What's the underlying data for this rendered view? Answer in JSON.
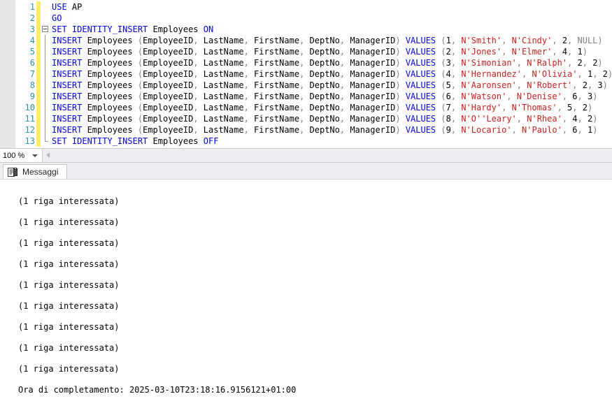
{
  "editor": {
    "zoom_level": "100 %",
    "lines": [
      {
        "number": "1",
        "fold": "none",
        "tokens": [
          {
            "t": "kw",
            "s": "USE"
          },
          {
            "t": "pun",
            "s": " "
          },
          {
            "t": "id",
            "s": "AP"
          }
        ]
      },
      {
        "number": "2",
        "fold": "none",
        "tokens": [
          {
            "t": "kw",
            "s": "GO"
          }
        ]
      },
      {
        "number": "3",
        "fold": "start",
        "tokens": [
          {
            "t": "kw",
            "s": "SET IDENTITY_INSERT"
          },
          {
            "t": "id",
            "s": " Employees "
          },
          {
            "t": "kw",
            "s": "ON"
          }
        ]
      },
      {
        "number": "4",
        "fold": "mid",
        "tokens": [
          {
            "t": "kw",
            "s": "INSERT"
          },
          {
            "t": "id",
            "s": " Employees "
          },
          {
            "t": "pun",
            "s": "("
          },
          {
            "t": "id",
            "s": "EmployeeID"
          },
          {
            "t": "pun",
            "s": ", "
          },
          {
            "t": "id",
            "s": "LastName"
          },
          {
            "t": "pun",
            "s": ", "
          },
          {
            "t": "id",
            "s": "FirstName"
          },
          {
            "t": "pun",
            "s": ", "
          },
          {
            "t": "id",
            "s": "DeptNo"
          },
          {
            "t": "pun",
            "s": ", "
          },
          {
            "t": "id",
            "s": "ManagerID"
          },
          {
            "t": "pun",
            "s": ") "
          },
          {
            "t": "kw",
            "s": "VALUES"
          },
          {
            "t": "pun",
            "s": " ("
          },
          {
            "t": "num",
            "s": "1"
          },
          {
            "t": "pun",
            "s": ", "
          },
          {
            "t": "str",
            "s": "N'Smith'"
          },
          {
            "t": "pun",
            "s": ", "
          },
          {
            "t": "str",
            "s": "N'Cindy'"
          },
          {
            "t": "pun",
            "s": ", "
          },
          {
            "t": "num",
            "s": "2"
          },
          {
            "t": "pun",
            "s": ", "
          },
          {
            "t": "null",
            "s": "NULL"
          },
          {
            "t": "pun",
            "s": ")"
          }
        ]
      },
      {
        "number": "5",
        "fold": "mid",
        "tokens": [
          {
            "t": "kw",
            "s": "INSERT"
          },
          {
            "t": "id",
            "s": " Employees "
          },
          {
            "t": "pun",
            "s": "("
          },
          {
            "t": "id",
            "s": "EmployeeID"
          },
          {
            "t": "pun",
            "s": ", "
          },
          {
            "t": "id",
            "s": "LastName"
          },
          {
            "t": "pun",
            "s": ", "
          },
          {
            "t": "id",
            "s": "FirstName"
          },
          {
            "t": "pun",
            "s": ", "
          },
          {
            "t": "id",
            "s": "DeptNo"
          },
          {
            "t": "pun",
            "s": ", "
          },
          {
            "t": "id",
            "s": "ManagerID"
          },
          {
            "t": "pun",
            "s": ") "
          },
          {
            "t": "kw",
            "s": "VALUES"
          },
          {
            "t": "pun",
            "s": " ("
          },
          {
            "t": "num",
            "s": "2"
          },
          {
            "t": "pun",
            "s": ", "
          },
          {
            "t": "str",
            "s": "N'Jones'"
          },
          {
            "t": "pun",
            "s": ", "
          },
          {
            "t": "str",
            "s": "N'Elmer'"
          },
          {
            "t": "pun",
            "s": ", "
          },
          {
            "t": "num",
            "s": "4"
          },
          {
            "t": "pun",
            "s": ", "
          },
          {
            "t": "num",
            "s": "1"
          },
          {
            "t": "pun",
            "s": ")"
          }
        ]
      },
      {
        "number": "6",
        "fold": "mid",
        "tokens": [
          {
            "t": "kw",
            "s": "INSERT"
          },
          {
            "t": "id",
            "s": " Employees "
          },
          {
            "t": "pun",
            "s": "("
          },
          {
            "t": "id",
            "s": "EmployeeID"
          },
          {
            "t": "pun",
            "s": ", "
          },
          {
            "t": "id",
            "s": "LastName"
          },
          {
            "t": "pun",
            "s": ", "
          },
          {
            "t": "id",
            "s": "FirstName"
          },
          {
            "t": "pun",
            "s": ", "
          },
          {
            "t": "id",
            "s": "DeptNo"
          },
          {
            "t": "pun",
            "s": ", "
          },
          {
            "t": "id",
            "s": "ManagerID"
          },
          {
            "t": "pun",
            "s": ") "
          },
          {
            "t": "kw",
            "s": "VALUES"
          },
          {
            "t": "pun",
            "s": " ("
          },
          {
            "t": "num",
            "s": "3"
          },
          {
            "t": "pun",
            "s": ", "
          },
          {
            "t": "str",
            "s": "N'Simonian'"
          },
          {
            "t": "pun",
            "s": ", "
          },
          {
            "t": "str",
            "s": "N'Ralph'"
          },
          {
            "t": "pun",
            "s": ", "
          },
          {
            "t": "num",
            "s": "2"
          },
          {
            "t": "pun",
            "s": ", "
          },
          {
            "t": "num",
            "s": "2"
          },
          {
            "t": "pun",
            "s": ")"
          }
        ]
      },
      {
        "number": "7",
        "fold": "mid",
        "tokens": [
          {
            "t": "kw",
            "s": "INSERT"
          },
          {
            "t": "id",
            "s": " Employees "
          },
          {
            "t": "pun",
            "s": "("
          },
          {
            "t": "id",
            "s": "EmployeeID"
          },
          {
            "t": "pun",
            "s": ", "
          },
          {
            "t": "id",
            "s": "LastName"
          },
          {
            "t": "pun",
            "s": ", "
          },
          {
            "t": "id",
            "s": "FirstName"
          },
          {
            "t": "pun",
            "s": ", "
          },
          {
            "t": "id",
            "s": "DeptNo"
          },
          {
            "t": "pun",
            "s": ", "
          },
          {
            "t": "id",
            "s": "ManagerID"
          },
          {
            "t": "pun",
            "s": ") "
          },
          {
            "t": "kw",
            "s": "VALUES"
          },
          {
            "t": "pun",
            "s": " ("
          },
          {
            "t": "num",
            "s": "4"
          },
          {
            "t": "pun",
            "s": ", "
          },
          {
            "t": "str",
            "s": "N'Hernandez'"
          },
          {
            "t": "pun",
            "s": ", "
          },
          {
            "t": "str",
            "s": "N'Olivia'"
          },
          {
            "t": "pun",
            "s": ", "
          },
          {
            "t": "num",
            "s": "1"
          },
          {
            "t": "pun",
            "s": ", "
          },
          {
            "t": "num",
            "s": "2"
          },
          {
            "t": "pun",
            "s": ")"
          }
        ]
      },
      {
        "number": "8",
        "fold": "mid",
        "tokens": [
          {
            "t": "kw",
            "s": "INSERT"
          },
          {
            "t": "id",
            "s": " Employees "
          },
          {
            "t": "pun",
            "s": "("
          },
          {
            "t": "id",
            "s": "EmployeeID"
          },
          {
            "t": "pun",
            "s": ", "
          },
          {
            "t": "id",
            "s": "LastName"
          },
          {
            "t": "pun",
            "s": ", "
          },
          {
            "t": "id",
            "s": "FirstName"
          },
          {
            "t": "pun",
            "s": ", "
          },
          {
            "t": "id",
            "s": "DeptNo"
          },
          {
            "t": "pun",
            "s": ", "
          },
          {
            "t": "id",
            "s": "ManagerID"
          },
          {
            "t": "pun",
            "s": ") "
          },
          {
            "t": "kw",
            "s": "VALUES"
          },
          {
            "t": "pun",
            "s": " ("
          },
          {
            "t": "num",
            "s": "5"
          },
          {
            "t": "pun",
            "s": ", "
          },
          {
            "t": "str",
            "s": "N'Aaronsen'"
          },
          {
            "t": "pun",
            "s": ", "
          },
          {
            "t": "str",
            "s": "N'Robert'"
          },
          {
            "t": "pun",
            "s": ", "
          },
          {
            "t": "num",
            "s": "2"
          },
          {
            "t": "pun",
            "s": ", "
          },
          {
            "t": "num",
            "s": "3"
          },
          {
            "t": "pun",
            "s": ")"
          }
        ]
      },
      {
        "number": "9",
        "fold": "mid",
        "tokens": [
          {
            "t": "kw",
            "s": "INSERT"
          },
          {
            "t": "id",
            "s": " Employees "
          },
          {
            "t": "pun",
            "s": "("
          },
          {
            "t": "id",
            "s": "EmployeeID"
          },
          {
            "t": "pun",
            "s": ", "
          },
          {
            "t": "id",
            "s": "LastName"
          },
          {
            "t": "pun",
            "s": ", "
          },
          {
            "t": "id",
            "s": "FirstName"
          },
          {
            "t": "pun",
            "s": ", "
          },
          {
            "t": "id",
            "s": "DeptNo"
          },
          {
            "t": "pun",
            "s": ", "
          },
          {
            "t": "id",
            "s": "ManagerID"
          },
          {
            "t": "pun",
            "s": ") "
          },
          {
            "t": "kw",
            "s": "VALUES"
          },
          {
            "t": "pun",
            "s": " ("
          },
          {
            "t": "num",
            "s": "6"
          },
          {
            "t": "pun",
            "s": ", "
          },
          {
            "t": "str",
            "s": "N'Watson'"
          },
          {
            "t": "pun",
            "s": ", "
          },
          {
            "t": "str",
            "s": "N'Denise'"
          },
          {
            "t": "pun",
            "s": ", "
          },
          {
            "t": "num",
            "s": "6"
          },
          {
            "t": "pun",
            "s": ", "
          },
          {
            "t": "num",
            "s": "3"
          },
          {
            "t": "pun",
            "s": ")"
          }
        ]
      },
      {
        "number": "10",
        "fold": "mid",
        "tokens": [
          {
            "t": "kw",
            "s": "INSERT"
          },
          {
            "t": "id",
            "s": " Employees "
          },
          {
            "t": "pun",
            "s": "("
          },
          {
            "t": "id",
            "s": "EmployeeID"
          },
          {
            "t": "pun",
            "s": ", "
          },
          {
            "t": "id",
            "s": "LastName"
          },
          {
            "t": "pun",
            "s": ", "
          },
          {
            "t": "id",
            "s": "FirstName"
          },
          {
            "t": "pun",
            "s": ", "
          },
          {
            "t": "id",
            "s": "DeptNo"
          },
          {
            "t": "pun",
            "s": ", "
          },
          {
            "t": "id",
            "s": "ManagerID"
          },
          {
            "t": "pun",
            "s": ") "
          },
          {
            "t": "kw",
            "s": "VALUES"
          },
          {
            "t": "pun",
            "s": " ("
          },
          {
            "t": "num",
            "s": "7"
          },
          {
            "t": "pun",
            "s": ", "
          },
          {
            "t": "str",
            "s": "N'Hardy'"
          },
          {
            "t": "pun",
            "s": ", "
          },
          {
            "t": "str",
            "s": "N'Thomas'"
          },
          {
            "t": "pun",
            "s": ", "
          },
          {
            "t": "num",
            "s": "5"
          },
          {
            "t": "pun",
            "s": ", "
          },
          {
            "t": "num",
            "s": "2"
          },
          {
            "t": "pun",
            "s": ")"
          }
        ]
      },
      {
        "number": "11",
        "fold": "mid",
        "tokens": [
          {
            "t": "kw",
            "s": "INSERT"
          },
          {
            "t": "id",
            "s": " Employees "
          },
          {
            "t": "pun",
            "s": "("
          },
          {
            "t": "id",
            "s": "EmployeeID"
          },
          {
            "t": "pun",
            "s": ", "
          },
          {
            "t": "id",
            "s": "LastName"
          },
          {
            "t": "pun",
            "s": ", "
          },
          {
            "t": "id",
            "s": "FirstName"
          },
          {
            "t": "pun",
            "s": ", "
          },
          {
            "t": "id",
            "s": "DeptNo"
          },
          {
            "t": "pun",
            "s": ", "
          },
          {
            "t": "id",
            "s": "ManagerID"
          },
          {
            "t": "pun",
            "s": ") "
          },
          {
            "t": "kw",
            "s": "VALUES"
          },
          {
            "t": "pun",
            "s": " ("
          },
          {
            "t": "num",
            "s": "8"
          },
          {
            "t": "pun",
            "s": ", "
          },
          {
            "t": "str",
            "s": "N'O''Leary'"
          },
          {
            "t": "pun",
            "s": ", "
          },
          {
            "t": "str",
            "s": "N'Rhea'"
          },
          {
            "t": "pun",
            "s": ", "
          },
          {
            "t": "num",
            "s": "4"
          },
          {
            "t": "pun",
            "s": ", "
          },
          {
            "t": "num",
            "s": "2"
          },
          {
            "t": "pun",
            "s": ")"
          }
        ]
      },
      {
        "number": "12",
        "fold": "mid",
        "tokens": [
          {
            "t": "kw",
            "s": "INSERT"
          },
          {
            "t": "id",
            "s": " Employees "
          },
          {
            "t": "pun",
            "s": "("
          },
          {
            "t": "id",
            "s": "EmployeeID"
          },
          {
            "t": "pun",
            "s": ", "
          },
          {
            "t": "id",
            "s": "LastName"
          },
          {
            "t": "pun",
            "s": ", "
          },
          {
            "t": "id",
            "s": "FirstName"
          },
          {
            "t": "pun",
            "s": ", "
          },
          {
            "t": "id",
            "s": "DeptNo"
          },
          {
            "t": "pun",
            "s": ", "
          },
          {
            "t": "id",
            "s": "ManagerID"
          },
          {
            "t": "pun",
            "s": ") "
          },
          {
            "t": "kw",
            "s": "VALUES"
          },
          {
            "t": "pun",
            "s": " ("
          },
          {
            "t": "num",
            "s": "9"
          },
          {
            "t": "pun",
            "s": ", "
          },
          {
            "t": "str",
            "s": "N'Locario'"
          },
          {
            "t": "pun",
            "s": ", "
          },
          {
            "t": "str",
            "s": "N'Paulo'"
          },
          {
            "t": "pun",
            "s": ", "
          },
          {
            "t": "num",
            "s": "6"
          },
          {
            "t": "pun",
            "s": ", "
          },
          {
            "t": "num",
            "s": "1"
          },
          {
            "t": "pun",
            "s": ")"
          }
        ]
      },
      {
        "number": "13",
        "fold": "end",
        "tokens": [
          {
            "t": "kw",
            "s": "SET IDENTITY_INSERT"
          },
          {
            "t": "id",
            "s": " Employees "
          },
          {
            "t": "kw",
            "s": "OFF"
          }
        ]
      }
    ]
  },
  "results": {
    "tab_label": "Messaggi",
    "tab_icon": "messages-icon"
  },
  "messages": {
    "rows_affected_lines": [
      "(1 riga interessata)",
      "(1 riga interessata)",
      "(1 riga interessata)",
      "(1 riga interessata)",
      "(1 riga interessata)",
      "(1 riga interessata)",
      "(1 riga interessata)",
      "(1 riga interessata)",
      "(1 riga interessata)"
    ],
    "completion_time": "Ora di completamento: 2025-03-10T23:18:16.9156121+01:00"
  },
  "colors": {
    "keyword": "#0000ff",
    "string": "#cc2020",
    "punctuation": "#808080",
    "null": "#808080",
    "line_number": "#2b91af",
    "change_bar": "#ffee62",
    "chrome": "#eeeef2"
  }
}
